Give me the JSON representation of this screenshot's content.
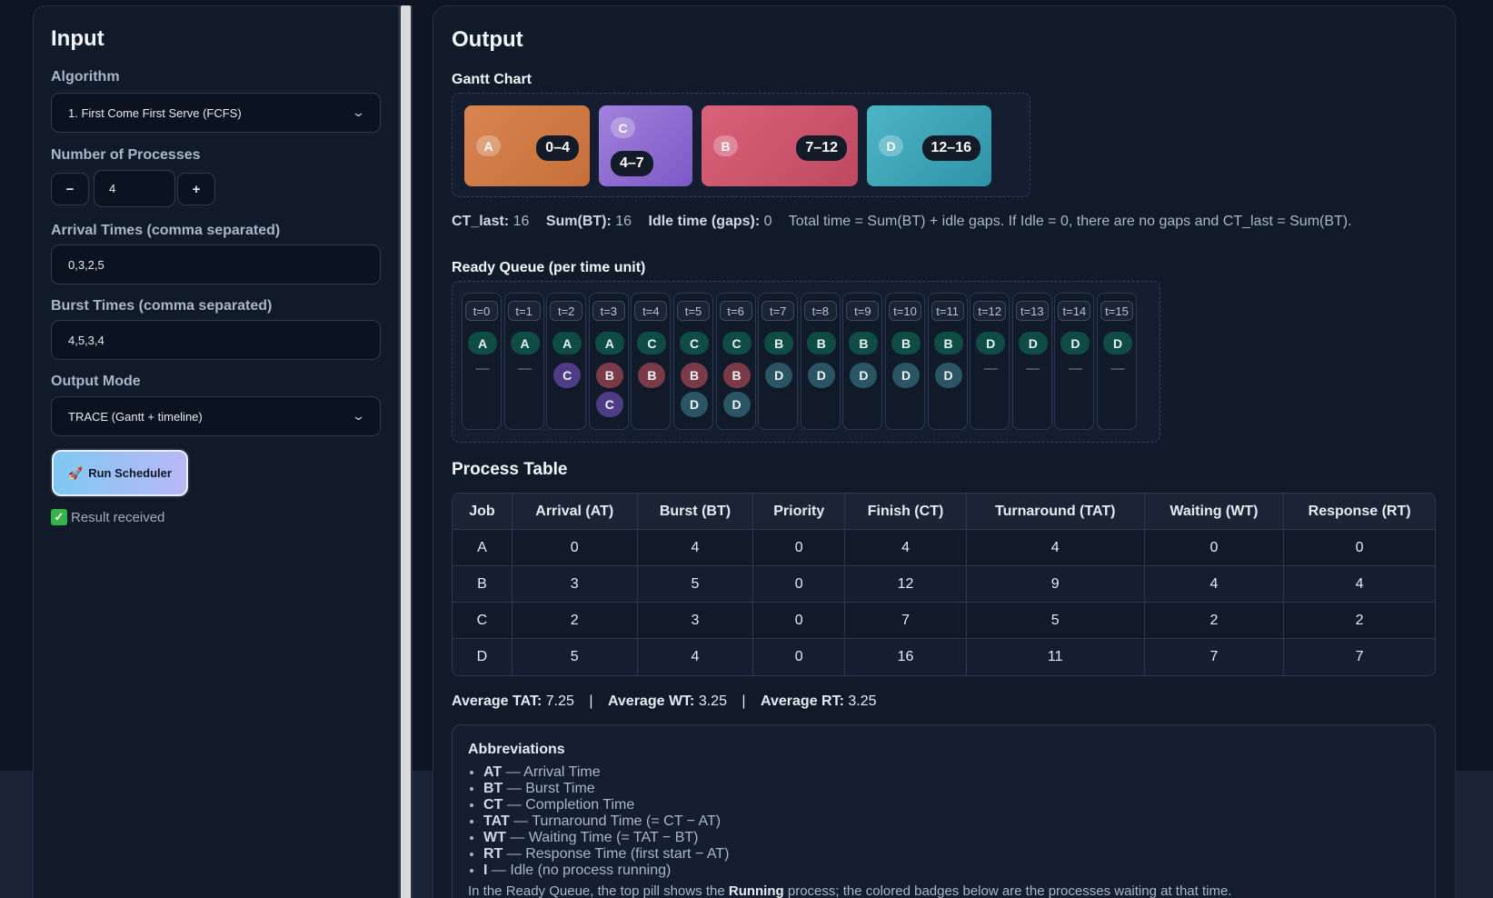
{
  "input": {
    "title": "Input",
    "algorithm_label": "Algorithm",
    "algorithm_value": "1. First Come First Serve (FCFS)",
    "num_processes_label": "Number of Processes",
    "num_processes_value": "4",
    "minus_label": "−",
    "plus_label": "+",
    "arrival_label": "Arrival Times (comma separated)",
    "arrival_value": "0,3,2,5",
    "burst_label": "Burst Times (comma separated)",
    "burst_value": "4,5,3,4",
    "output_mode_label": "Output Mode",
    "output_mode_value": "TRACE (Gantt + timeline)",
    "run_icon": "🚀",
    "run_label": "Run Scheduler",
    "status_text": "Result received"
  },
  "output": {
    "title": "Output",
    "gantt_title": "Gantt Chart",
    "gantt": [
      {
        "job": "A",
        "range": "0–4",
        "color1": "#d98451",
        "color2": "#c66f3a"
      },
      {
        "job": "C",
        "range": "4–7",
        "color1": "#a281dc",
        "color2": "#7c58c6"
      },
      {
        "job": "B",
        "range": "7–12",
        "color1": "#d9627a",
        "color2": "#bf4960"
      },
      {
        "job": "D",
        "range": "12–16",
        "color1": "#4cb5c5",
        "color2": "#2f93a8"
      }
    ],
    "stats": {
      "ct_label": "CT_last:",
      "ct_value": "16",
      "sum_label": "Sum(BT):",
      "sum_value": "16",
      "idle_label": "Idle time (gaps):",
      "idle_value": "0",
      "note": "Total time = Sum(BT) + idle gaps. If Idle = 0, there are no gaps and CT_last = Sum(BT)."
    },
    "ready_title": "Ready Queue (per time unit)",
    "ready_queue": [
      {
        "t": "t=0",
        "run": "A",
        "queue": []
      },
      {
        "t": "t=1",
        "run": "A",
        "queue": []
      },
      {
        "t": "t=2",
        "run": "A",
        "queue": [
          "C"
        ]
      },
      {
        "t": "t=3",
        "run": "A",
        "queue": [
          "B",
          "C"
        ]
      },
      {
        "t": "t=4",
        "run": "C",
        "queue": [
          "B"
        ]
      },
      {
        "t": "t=5",
        "run": "C",
        "queue": [
          "B",
          "D"
        ]
      },
      {
        "t": "t=6",
        "run": "C",
        "queue": [
          "B",
          "D"
        ]
      },
      {
        "t": "t=7",
        "run": "B",
        "queue": [
          "D"
        ]
      },
      {
        "t": "t=8",
        "run": "B",
        "queue": [
          "D"
        ]
      },
      {
        "t": "t=9",
        "run": "B",
        "queue": [
          "D"
        ]
      },
      {
        "t": "t=10",
        "run": "B",
        "queue": [
          "D"
        ]
      },
      {
        "t": "t=11",
        "run": "B",
        "queue": [
          "D"
        ]
      },
      {
        "t": "t=12",
        "run": "D",
        "queue": []
      },
      {
        "t": "t=13",
        "run": "D",
        "queue": []
      },
      {
        "t": "t=14",
        "run": "D",
        "queue": []
      },
      {
        "t": "t=15",
        "run": "D",
        "queue": []
      }
    ],
    "empty_marker": "—",
    "queue_colors": {
      "A": "#1f6e5e",
      "B": "#7a3a48",
      "C": "#4e3d86",
      "D": "#2a5565"
    },
    "table_title": "Process Table",
    "table_headers": [
      "Job",
      "Arrival (AT)",
      "Burst (BT)",
      "Priority",
      "Finish (CT)",
      "Turnaround (TAT)",
      "Waiting (WT)",
      "Response (RT)"
    ],
    "table_rows": [
      [
        "A",
        "0",
        "4",
        "0",
        "4",
        "4",
        "0",
        "0"
      ],
      [
        "B",
        "3",
        "5",
        "0",
        "12",
        "9",
        "4",
        "4"
      ],
      [
        "C",
        "2",
        "3",
        "0",
        "7",
        "5",
        "2",
        "2"
      ],
      [
        "D",
        "5",
        "4",
        "0",
        "16",
        "11",
        "7",
        "7"
      ]
    ],
    "averages": {
      "tat_label": "Average TAT:",
      "tat_value": "7.25",
      "wt_label": "Average WT:",
      "wt_value": "3.25",
      "rt_label": "Average RT:",
      "rt_value": "3.25",
      "sep": "|"
    },
    "abbr_title": "Abbreviations",
    "abbreviations": [
      {
        "key": "AT",
        "text": "— Arrival Time"
      },
      {
        "key": "BT",
        "text": "— Burst Time"
      },
      {
        "key": "CT",
        "text": "— Completion Time"
      },
      {
        "key": "TAT",
        "text": "— Turnaround Time (= CT − AT)"
      },
      {
        "key": "WT",
        "text": "— Waiting Time (= TAT − BT)"
      },
      {
        "key": "RT",
        "text": "— Response Time (first start − AT)"
      },
      {
        "key": "I",
        "text": "— Idle (no process running)"
      }
    ],
    "note_pre": "In the Ready Queue, the top pill shows the",
    "note_bold": "Running",
    "note_post": "process; the colored badges below are the processes waiting at that time."
  }
}
